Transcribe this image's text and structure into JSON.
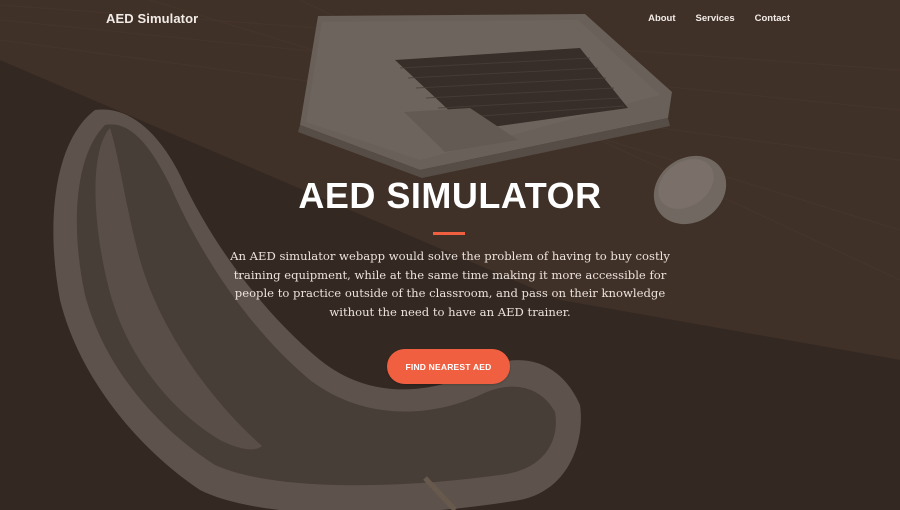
{
  "navbar": {
    "brand": "AED Simulator",
    "links": [
      {
        "label": "About"
      },
      {
        "label": "Services"
      },
      {
        "label": "Contact"
      }
    ]
  },
  "hero": {
    "title": "AED SIMULATOR",
    "description": "An AED simulator webapp would solve the problem of having to buy costly training equipment, while at the same time making it more accessible for people to practice outside of the classroom, and pass on their knowledge without the need to have an AED trainer.",
    "cta_label": "FIND NEAREST AED"
  },
  "colors": {
    "accent": "#f05f40",
    "overlay": "#3a302a",
    "text": "#ffffff"
  },
  "background": {
    "depicts": [
      "laptop",
      "mouse",
      "chair",
      "desk"
    ]
  }
}
